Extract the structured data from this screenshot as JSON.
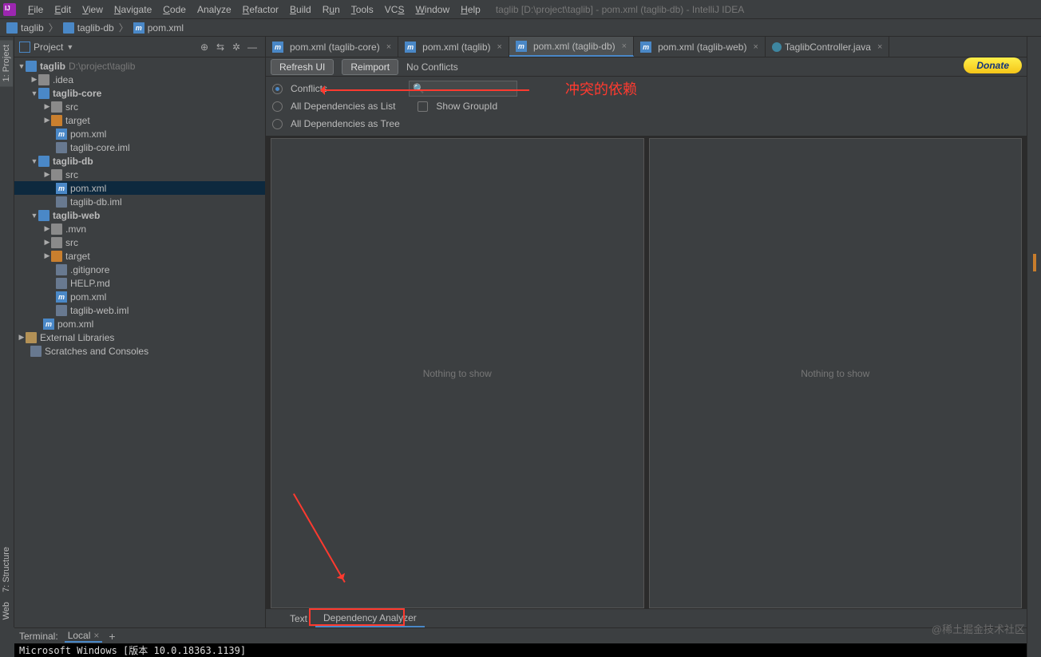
{
  "menubar": {
    "items": [
      "File",
      "Edit",
      "View",
      "Navigate",
      "Code",
      "Analyze",
      "Refactor",
      "Build",
      "Run",
      "Tools",
      "VCS",
      "Window",
      "Help"
    ],
    "titlePath": "taglib [D:\\project\\taglib] - pom.xml (taglib-db) - IntelliJ IDEA"
  },
  "breadcrumb": {
    "crumbs": [
      "taglib",
      "taglib-db",
      "pom.xml"
    ]
  },
  "leftGutter": {
    "project": "1: Project",
    "structure": "7: Structure",
    "web": "Web"
  },
  "projectPane": {
    "title": "Project",
    "root": {
      "name": "taglib",
      "path": "D:\\project\\taglib"
    },
    "ideaFolder": ".idea",
    "taglibCore": {
      "name": "taglib-core",
      "src": "src",
      "target": "target",
      "pom": "pom.xml",
      "iml": "taglib-core.iml"
    },
    "taglibDb": {
      "name": "taglib-db",
      "src": "src",
      "pom": "pom.xml",
      "iml": "taglib-db.iml"
    },
    "taglibWeb": {
      "name": "taglib-web",
      "mvn": ".mvn",
      "src": "src",
      "target": "target",
      "gitignore": ".gitignore",
      "help": "HELP.md",
      "pom": "pom.xml",
      "iml": "taglib-web.iml"
    },
    "rootPom": "pom.xml",
    "external": "External Libraries",
    "scratches": "Scratches and Consoles"
  },
  "editorTabs": {
    "t1": "pom.xml (taglib-core)",
    "t2": "pom.xml (taglib)",
    "t3": "pom.xml (taglib-db)",
    "t4": "pom.xml (taglib-web)",
    "t5": "TaglibController.java"
  },
  "depToolbar": {
    "refresh": "Refresh UI",
    "reimport": "Reimport",
    "noConflicts": "No Conflicts",
    "donate": "Donate"
  },
  "depOptions": {
    "conflicts": "Conflicts",
    "asList": "All Dependencies as List",
    "asTree": "All Dependencies as Tree",
    "showGroupId": "Show GroupId"
  },
  "annotation": {
    "label": "冲突的依赖"
  },
  "panes": {
    "left": "Nothing to show",
    "right": "Nothing to show"
  },
  "bottomTabs": {
    "text": "Text",
    "analyzer": "Dependency Analyzer"
  },
  "terminal": {
    "label": "Terminal:",
    "tab": "Local",
    "body": "Microsoft Windows [版本 10.0.18363.1139]"
  },
  "watermark": "@稀土掘金技术社区"
}
